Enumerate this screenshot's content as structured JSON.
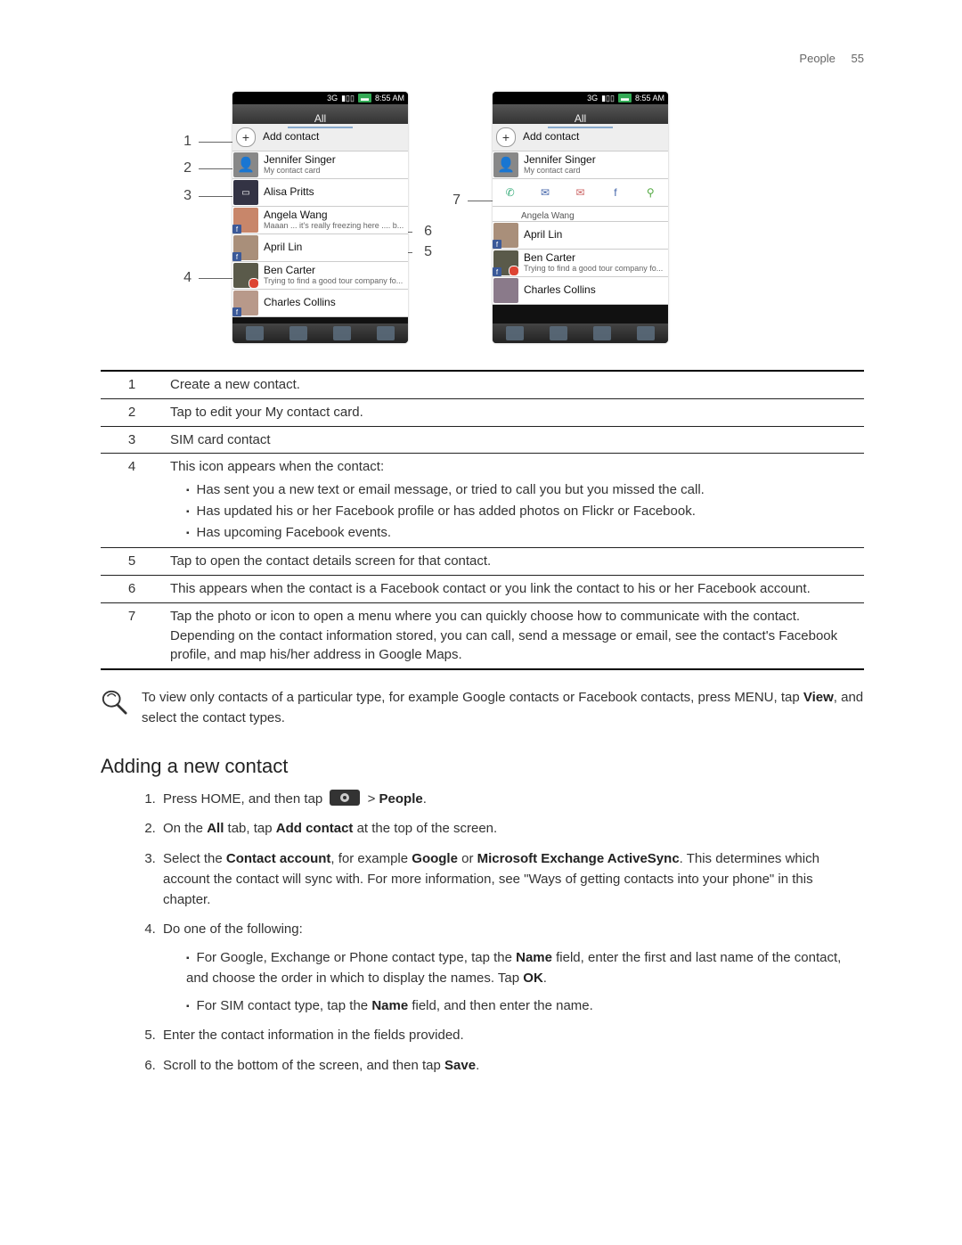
{
  "header": {
    "section": "People",
    "page": "55"
  },
  "phone": {
    "time": "8:55 AM",
    "net": "3G",
    "tab": "All",
    "add": "Add contact",
    "me_name": "Jennifer Singer",
    "me_sub": "My contact card",
    "c1": "Alisa Pritts",
    "c2": "Angela Wang",
    "c2_sub": "Maaan ... it's really freezing here .... b...",
    "c2_peek": "Angela Wang",
    "c3": "April  Lin",
    "c4": "Ben Carter",
    "c4_sub": "Trying to find a good tour company fo...",
    "c5": "Charles  Collins"
  },
  "callouts": {
    "n1": "1",
    "n2": "2",
    "n3": "3",
    "n4": "4",
    "n5": "5",
    "n6": "6",
    "n7": "7"
  },
  "legend": {
    "r1": "Create a new contact.",
    "r2": "Tap to edit your My contact card.",
    "r3": "SIM card contact",
    "r4": "This icon appears when the contact:",
    "r4a": "Has sent you a new text or email message, or tried to call you but you missed the call.",
    "r4b": "Has updated his or her Facebook profile or has added photos on Flickr or Facebook.",
    "r4c": "Has upcoming Facebook events.",
    "r5": "Tap to open the contact details screen for that contact.",
    "r6": "This appears when the contact is a Facebook contact or you link the contact to his or her Facebook account.",
    "r7": "Tap the photo or icon to open a menu where you can quickly choose how to communicate with the contact. Depending on the contact information stored, you can call, send a message or email, see the contact's Facebook profile, and map his/her address in Google Maps."
  },
  "tip": {
    "pre": "To view only contacts of a particular type, for example Google contacts or Facebook contacts, press MENU, tap ",
    "bold": "View",
    "post": ", and select the contact types."
  },
  "section_title": "Adding a new contact",
  "steps": {
    "s1_pre": "Press HOME, and then tap ",
    "s1_post_bold": "People",
    "s1_gt": " > ",
    "s1_end": ".",
    "s2_a": "On the ",
    "s2_b": "All",
    "s2_c": " tab, tap ",
    "s2_d": "Add contact",
    "s2_e": " at the top of the screen.",
    "s3_a": "Select the ",
    "s3_b": "Contact account",
    "s3_c": ", for example ",
    "s3_d": "Google",
    "s3_e": " or ",
    "s3_f": "Microsoft Exchange ActiveSync",
    "s3_g": ". This determines which account the contact will sync with. For more information, see \"Ways of getting contacts into your phone\" in this chapter.",
    "s4": "Do one of the following:",
    "s4a_a": "For Google, Exchange or Phone contact type, tap the ",
    "s4a_b": "Name",
    "s4a_c": " field, enter the first and last name of the contact, and choose the order in which to display the names. Tap ",
    "s4a_d": "OK",
    "s4a_e": ".",
    "s4b_a": "For SIM contact type, tap the ",
    "s4b_b": "Name",
    "s4b_c": " field, and then enter the name.",
    "s5": "Enter the contact information in the fields provided.",
    "s6_a": "Scroll to the bottom of the screen, and then tap ",
    "s6_b": "Save",
    "s6_c": "."
  }
}
